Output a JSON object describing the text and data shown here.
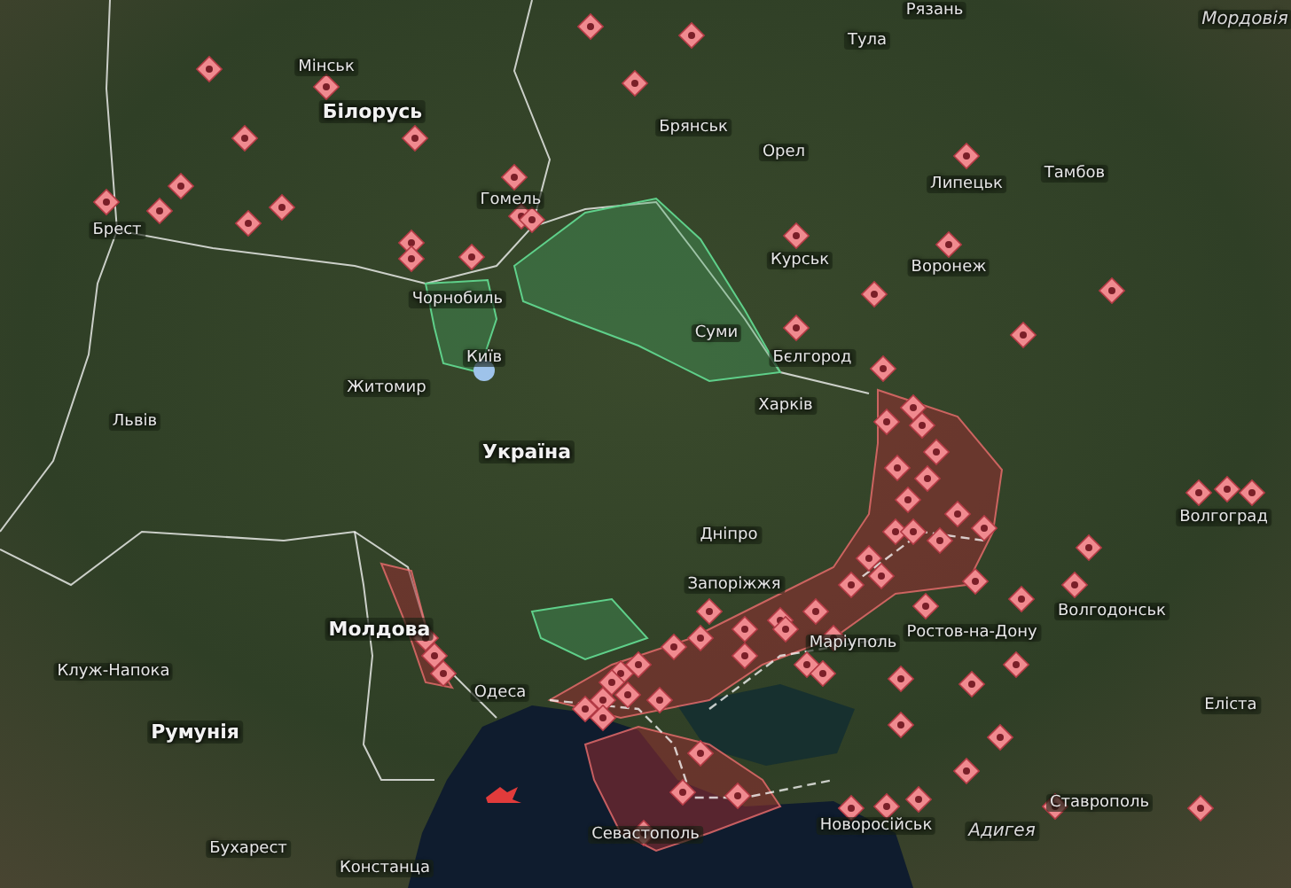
{
  "map": {
    "labels": [
      {
        "text": "Білорусь",
        "kind": "country"
      },
      {
        "text": "Україна",
        "kind": "country"
      },
      {
        "text": "Молдова",
        "kind": "country"
      },
      {
        "text": "Румунія",
        "kind": "country"
      },
      {
        "text": "Мінськ",
        "kind": "city"
      },
      {
        "text": "Брест",
        "kind": "city"
      },
      {
        "text": "Гомель",
        "kind": "city"
      },
      {
        "text": "Чорнобиль",
        "kind": "city"
      },
      {
        "text": "Київ",
        "kind": "city"
      },
      {
        "text": "Житомир",
        "kind": "city"
      },
      {
        "text": "Львів",
        "kind": "city"
      },
      {
        "text": "Рязань",
        "kind": "city"
      },
      {
        "text": "Тула",
        "kind": "city"
      },
      {
        "text": "Брянськ",
        "kind": "city"
      },
      {
        "text": "Орел",
        "kind": "city"
      },
      {
        "text": "Липецьк",
        "kind": "city"
      },
      {
        "text": "Тамбов",
        "kind": "city"
      },
      {
        "text": "Курськ",
        "kind": "city"
      },
      {
        "text": "Воронеж",
        "kind": "city"
      },
      {
        "text": "Суми",
        "kind": "city"
      },
      {
        "text": "Бєлгород",
        "kind": "city"
      },
      {
        "text": "Харків",
        "kind": "city"
      },
      {
        "text": "Дніпро",
        "kind": "city"
      },
      {
        "text": "Запоріжжя",
        "kind": "city"
      },
      {
        "text": "Маріуполь",
        "kind": "city"
      },
      {
        "text": "Ростов-на-Дону",
        "kind": "city"
      },
      {
        "text": "Волгоград",
        "kind": "city"
      },
      {
        "text": "Волгодонськ",
        "kind": "city"
      },
      {
        "text": "Еліста",
        "kind": "city"
      },
      {
        "text": "Клуж-Напока",
        "kind": "city"
      },
      {
        "text": "Одеса",
        "kind": "city"
      },
      {
        "text": "Бухарест",
        "kind": "city"
      },
      {
        "text": "Констанца",
        "kind": "city"
      },
      {
        "text": "Севастополь",
        "kind": "city"
      },
      {
        "text": "Новоросійськ",
        "kind": "city"
      },
      {
        "text": "Адигея",
        "kind": "region"
      },
      {
        "text": "Ставрополь",
        "kind": "city"
      },
      {
        "text": "Мордовія",
        "kind": "region"
      }
    ]
  }
}
